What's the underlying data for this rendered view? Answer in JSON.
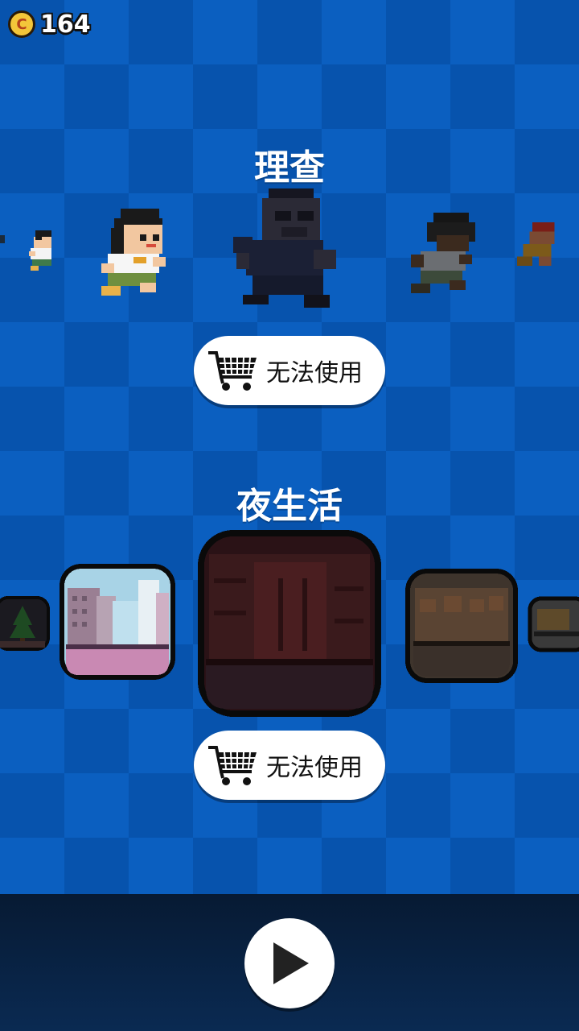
{
  "coins": {
    "count": "164",
    "icon": "coin-icon",
    "symbol": "C"
  },
  "characters": {
    "title": "理查",
    "button_label": "无法使用",
    "button_icon": "shopping-cart-icon"
  },
  "stages": {
    "title": "夜生活",
    "button_label": "无法使用",
    "button_icon": "shopping-cart-icon"
  },
  "play": {
    "icon": "play-icon"
  },
  "colors": {
    "background": "#0753ad",
    "background_alt": "#0b5fc0",
    "bottom_bar": "#071a33",
    "button_bg": "#ffffff"
  }
}
